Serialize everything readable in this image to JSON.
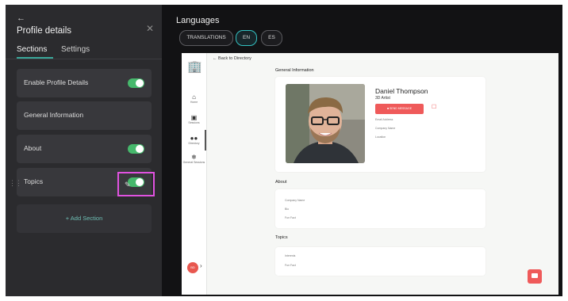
{
  "panel": {
    "back_icon": "arrow-left-icon",
    "title": "Profile details",
    "close_icon": "close-icon",
    "tabs": [
      {
        "label": "Sections",
        "active": true
      },
      {
        "label": "Settings",
        "active": false
      }
    ],
    "sections": [
      {
        "label": "Enable Profile Details",
        "toggle_on": true
      },
      {
        "label": "General Information",
        "toggle_on": null
      },
      {
        "label": "About",
        "toggle_on": true
      },
      {
        "label": "Topics",
        "toggle_on": true
      }
    ],
    "add_section_label": "+ Add Section",
    "accent_color": "#46b86c",
    "highlight_color": "#e052e0"
  },
  "languages": {
    "title": "Languages",
    "buttons": [
      {
        "label": "TRANSLATIONS",
        "active": false
      },
      {
        "label": "EN",
        "active": true
      },
      {
        "label": "ES",
        "active": false
      }
    ]
  },
  "preview": {
    "back_link": "← Back to Directory",
    "rail": {
      "logo_icon": "building-icon",
      "items": [
        {
          "icon": "home-icon",
          "label": "Home"
        },
        {
          "icon": "calendar-icon",
          "label": "Sessions"
        },
        {
          "icon": "people-icon",
          "label": "Directory"
        },
        {
          "icon": "tree-icon",
          "label": "General Sessions"
        }
      ],
      "avatar_text": "BD"
    },
    "general": {
      "heading": "General Information",
      "name": "Daniel Thompson",
      "role": "3D Artist",
      "message_button": "SEND MESSAGE",
      "email_label": "Email Address",
      "company_label": "Company Name",
      "location_label": "Location"
    },
    "about": {
      "heading": "About",
      "fields": [
        "Company Name",
        "Bio",
        "Fun Fact"
      ]
    },
    "topics": {
      "heading": "Topics",
      "fields": [
        "Interests",
        "Fun Fact"
      ]
    },
    "brand_color": "#ef5a5a"
  }
}
